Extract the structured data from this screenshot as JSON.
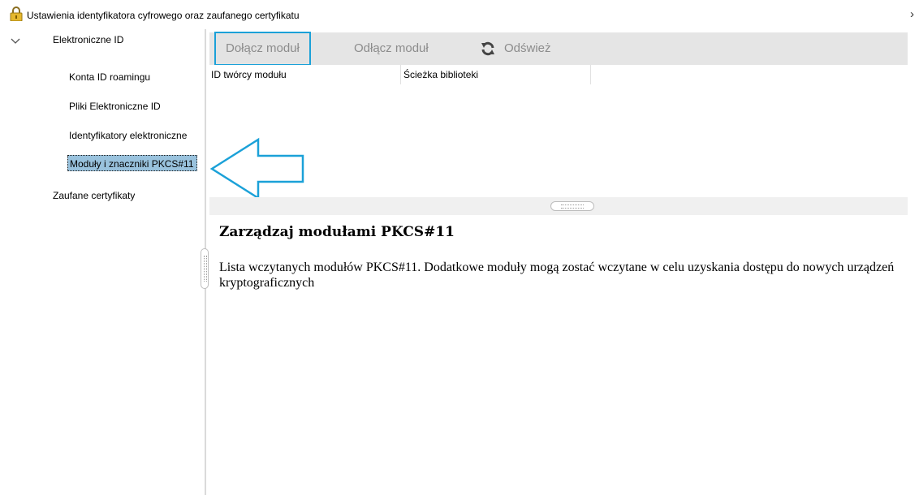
{
  "window": {
    "title": "Ustawienia identyfikatora cyfrowego oraz zaufanego certyfikatu",
    "more_glyph": "›"
  },
  "sidebar": {
    "root_label": "Elektroniczne ID",
    "children": [
      {
        "label": "Konta ID roamingu"
      },
      {
        "label": "Pliki Elektroniczne ID"
      },
      {
        "label": "Identyfikatory elektroniczne"
      },
      {
        "label": "Moduły i znaczniki PKCS#11",
        "selected": true
      }
    ],
    "trusted_label": "Zaufane certyfikaty"
  },
  "toolbar": {
    "attach_label": "Dołącz moduł",
    "detach_label": "Odłącz moduł",
    "refresh_label": "Odśwież"
  },
  "table": {
    "columns": [
      "ID twórcy modułu",
      "Ścieżka biblioteki"
    ]
  },
  "description": {
    "title": "Zarządzaj modułami PKCS#11",
    "text": "Lista wczytanych modułów PKCS#11. Dodatkowe moduły mogą zostać wczytane w celu uzyskania dostępu do nowych urządzeń kryptograficznych"
  },
  "colors": {
    "selection": "#99c2dd",
    "focus_border": "#1ba1d8",
    "arrow": "#1ba1d8",
    "toolbar_bg": "#e5e5e5",
    "disabled_text": "#8c8c8c"
  },
  "icons": {
    "window": "lock-icon",
    "tree_toggle": "chevron-down-icon",
    "refresh": "refresh-icon",
    "annotation": "arrow-left-icon"
  }
}
